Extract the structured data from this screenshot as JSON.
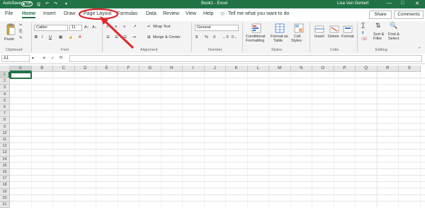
{
  "titlebar": {
    "autosave_label": "AutoSave",
    "autosave_state": "Off",
    "doc_title": "Book1 - Excel",
    "user_name": "Lisa Van Gemert"
  },
  "tabs": [
    {
      "label": "File"
    },
    {
      "label": "Home"
    },
    {
      "label": "Insert"
    },
    {
      "label": "Draw"
    },
    {
      "label": "Page Layout"
    },
    {
      "label": "Formulas"
    },
    {
      "label": "Data"
    },
    {
      "label": "Review"
    },
    {
      "label": "View"
    },
    {
      "label": "Help"
    }
  ],
  "active_tab": "Home",
  "tell_me": "Tell me what you want to do",
  "share_label": "Share",
  "comments_label": "Comments",
  "ribbon": {
    "clipboard": {
      "label": "Clipboard",
      "paste": "Paste"
    },
    "font": {
      "label": "Font",
      "font_name": "Calibri",
      "font_size": "11",
      "bold": "B",
      "italic": "I",
      "underline": "U"
    },
    "alignment": {
      "label": "Alignment",
      "wrap_text": "Wrap Text",
      "merge_center": "Merge & Center"
    },
    "number": {
      "label": "Number",
      "format": "General",
      "currency": "$",
      "percent": "%",
      "comma": "9"
    },
    "styles": {
      "label": "Styles",
      "conditional": "Conditional",
      "conditional2": "Formatting",
      "format_as": "Format as",
      "table": "Table",
      "cell": "Cell",
      "styles2": "Styles"
    },
    "cells": {
      "label": "Cells",
      "insert": "Insert",
      "delete": "Delete",
      "format": "Format"
    },
    "editing": {
      "label": "Editing",
      "sort": "Sort &",
      "filter": "Filter",
      "find": "Find &",
      "select": "Select"
    }
  },
  "formula_bar": {
    "name_box": "A1",
    "fx": "fx",
    "content": ""
  },
  "columns": [
    "A",
    "B",
    "C",
    "D",
    "E",
    "F",
    "G",
    "H",
    "I",
    "J",
    "K",
    "L",
    "M",
    "N",
    "O",
    "P",
    "Q",
    "R",
    "S"
  ],
  "rows": [
    "1",
    "2",
    "3",
    "4",
    "5",
    "6",
    "7",
    "8",
    "9",
    "10",
    "11",
    "12",
    "13",
    "14",
    "15",
    "16",
    "17",
    "18",
    "19",
    "20",
    "21"
  ],
  "selected_cell": "A1",
  "colors": {
    "excel_green": "#217346",
    "annotation": "#e0262b"
  }
}
